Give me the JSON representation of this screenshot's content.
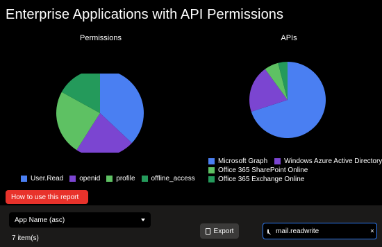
{
  "page": {
    "title": "Enterprise Applications with API Permissions"
  },
  "chart_data": [
    {
      "type": "pie",
      "title": "Permissions",
      "categories": [
        "User.Read",
        "openid",
        "profile",
        "offline_access"
      ],
      "values": [
        37,
        22,
        24,
        17
      ],
      "colors": [
        "#4a7ff2",
        "#7b45d1",
        "#5ec163",
        "#249a5b"
      ],
      "legend_position": "bottom"
    },
    {
      "type": "pie",
      "title": "APIs",
      "categories": [
        "Microsoft Graph",
        "Windows Azure Active Directory",
        "Office 365 SharePoint Online",
        "Office 365 Exchange Online"
      ],
      "values": [
        70,
        20,
        6,
        4
      ],
      "colors": [
        "#4a7ff2",
        "#7b45d1",
        "#5ec163",
        "#249a5b"
      ],
      "legend_position": "bottom"
    }
  ],
  "help_button": {
    "label": "How to use this report"
  },
  "toolbar": {
    "sort_select": "App Name (asc)",
    "export_label": "Export",
    "items_count": "7 item(s)"
  },
  "search": {
    "value": "mail.readwrite",
    "clear_glyph": "×"
  },
  "colors": {
    "background": "#000000",
    "panel": "#1b1a19",
    "accent": "#2f7bf6",
    "help_button": "#e8322b"
  },
  "icons": {
    "search": "search-icon",
    "clear": "close-icon",
    "export": "export-icon",
    "dropdown": "chevron-down-icon",
    "doc": "document-icon"
  }
}
